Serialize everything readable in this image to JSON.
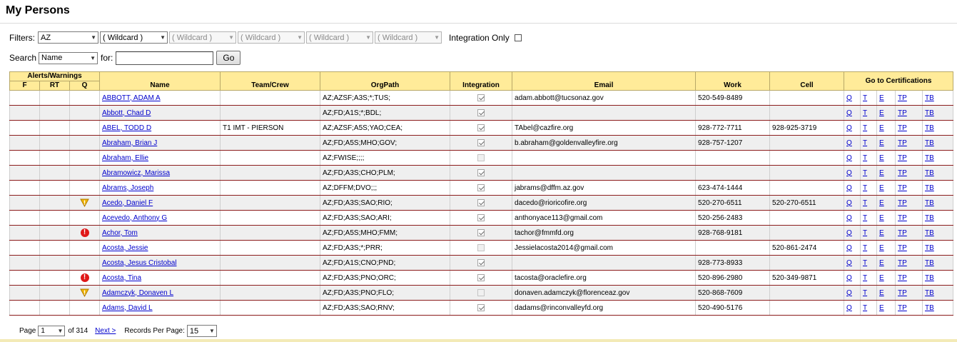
{
  "page": {
    "title": "My Persons"
  },
  "filters": {
    "label": "Filters:",
    "state": "AZ",
    "wildcards": [
      "( Wildcard )",
      "( Wildcard )",
      "( Wildcard )",
      "( Wildcard )",
      "( Wildcard )"
    ],
    "integration_label": "Integration Only"
  },
  "search": {
    "label": "Search",
    "field": "Name",
    "for_label": "for:",
    "value": "",
    "go_label": "Go"
  },
  "table": {
    "alerts_group": "Alerts/Warnings",
    "certs_group": "Go to Certifications",
    "col_f": "F",
    "col_rt": "RT",
    "col_q": "Q",
    "col_name": "Name",
    "col_team": "Team/Crew",
    "col_org": "OrgPath",
    "col_integration": "Integration",
    "col_email": "Email",
    "col_work": "Work",
    "col_cell": "Cell",
    "cert_links": [
      "Q",
      "T",
      "E",
      "TP",
      "TB"
    ],
    "rows": [
      {
        "name": "ABBOTT, ADAM A",
        "team": "",
        "org": "AZ;AZSF;A3S;*;TUS;",
        "integration": true,
        "email": "adam.abbott@tucsonaz.gov",
        "work": "520-549-8489",
        "cell": "",
        "q_alert": ""
      },
      {
        "name": "Abbott, Chad D",
        "team": "",
        "org": "AZ;FD;A1S;*;BDL;",
        "integration": true,
        "email": "",
        "work": "",
        "cell": "",
        "q_alert": ""
      },
      {
        "name": "ABEL, TODD D",
        "team": "T1 IMT - PIERSON",
        "org": "AZ;AZSF;A5S;YAO;CEA;",
        "integration": true,
        "email": "TAbel@cazfire.org",
        "work": "928-772-7711",
        "cell": "928-925-3719",
        "q_alert": ""
      },
      {
        "name": "Abraham, Brian J",
        "team": "",
        "org": "AZ;FD;A5S;MHO;GOV;",
        "integration": true,
        "email": "b.abraham@goldenvalleyfire.org",
        "work": "928-757-1207",
        "cell": "",
        "q_alert": ""
      },
      {
        "name": "Abraham, Ellie",
        "team": "",
        "org": "AZ;FWISE;;;;",
        "integration": false,
        "email": "",
        "work": "",
        "cell": "",
        "q_alert": ""
      },
      {
        "name": "Abramowicz, Marissa",
        "team": "",
        "org": "AZ;FD;A3S;CHO;PLM;",
        "integration": true,
        "email": "",
        "work": "",
        "cell": "",
        "q_alert": ""
      },
      {
        "name": "Abrams, Joseph",
        "team": "",
        "org": "AZ;DFFM;DVO;;;",
        "integration": true,
        "email": "jabrams@dffm.az.gov",
        "work": "623-474-1444",
        "cell": "",
        "q_alert": ""
      },
      {
        "name": "Acedo, Daniel F",
        "team": "",
        "org": "AZ;FD;A3S;SAO;RIO;",
        "integration": true,
        "email": "dacedo@rioricofire.org",
        "work": "520-270-6511",
        "cell": "520-270-6511",
        "q_alert": "warning"
      },
      {
        "name": "Acevedo, Anthony G",
        "team": "",
        "org": "AZ;FD;A3S;SAO;ARI;",
        "integration": true,
        "email": "anthonyace113@gmail.com",
        "work": "520-256-2483",
        "cell": "",
        "q_alert": ""
      },
      {
        "name": "Achor, Tom",
        "team": "",
        "org": "AZ;FD;A5S;MHO;FMM;",
        "integration": true,
        "email": "tachor@fmmfd.org",
        "work": "928-768-9181",
        "cell": "",
        "q_alert": "alert"
      },
      {
        "name": "Acosta, Jessie",
        "team": "",
        "org": "AZ;FD;A3S;*;PRR;",
        "integration": false,
        "email": "Jessielacosta2014@gmail.com",
        "work": "",
        "cell": "520-861-2474",
        "q_alert": ""
      },
      {
        "name": "Acosta, Jesus Cristobal",
        "team": "",
        "org": "AZ;FD;A1S;CNO;PND;",
        "integration": true,
        "email": "",
        "work": "928-773-8933",
        "cell": "",
        "q_alert": ""
      },
      {
        "name": "Acosta, Tina",
        "team": "",
        "org": "AZ;FD;A3S;PNO;ORC;",
        "integration": true,
        "email": "tacosta@oraclefire.org",
        "work": "520-896-2980",
        "cell": "520-349-9871",
        "q_alert": "alert"
      },
      {
        "name": "Adamczyk, Donaven L",
        "team": "",
        "org": "AZ;FD;A3S;PNO;FLO;",
        "integration": false,
        "email": "donaven.adamczyk@florenceaz.gov",
        "work": "520-868-7609",
        "cell": "",
        "q_alert": "warning"
      },
      {
        "name": "Adams, David L",
        "team": "",
        "org": "AZ;FD;A3S;SAO;RNV;",
        "integration": true,
        "email": "dadams@rinconvalleyfd.org",
        "work": "520-490-5176",
        "cell": "",
        "q_alert": ""
      }
    ]
  },
  "pager": {
    "page_label": "Page",
    "page_value": "1",
    "of_text": "of 314",
    "next_label": "Next >",
    "rpp_label": "Records Per Page:",
    "rpp_value": "15"
  }
}
